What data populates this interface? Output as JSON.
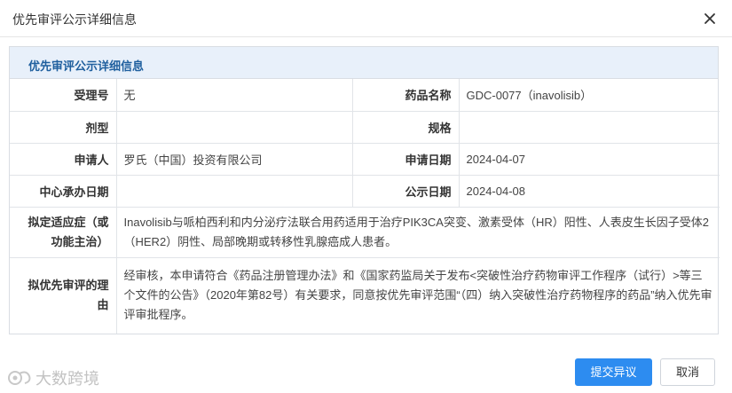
{
  "dialog": {
    "title": "优先审评公示详细信息",
    "close_icon": "close-icon"
  },
  "panel": {
    "heading": "优先审评公示详细信息"
  },
  "rows": [
    {
      "label1": "受理号",
      "value1": "无",
      "label2": "药品名称",
      "value2": "GDC-0077（inavolisib）"
    },
    {
      "label1": "剂型",
      "value1": "",
      "label2": "规格",
      "value2": ""
    },
    {
      "label1": "申请人",
      "value1": "罗氏（中国）投资有限公司",
      "label2": "申请日期",
      "value2": "2024-04-07"
    },
    {
      "label1": "中心承办日期",
      "value1": "",
      "label2": "公示日期",
      "value2": "2024-04-08"
    }
  ],
  "indication": {
    "label": "拟定适应症（或功能主治）",
    "value": "Inavolisib与哌柏西利和内分泌疗法联合用药适用于治疗PIK3CA突变、激素受体（HR）阳性、人表皮生长因子受体2（HER2）阴性、局部晚期或转移性乳腺癌成人患者。"
  },
  "reason": {
    "label": "拟优先审评的理由",
    "value": "经审核，本申请符合《药品注册管理办法》和《国家药监局关于发布<突破性治疗药物审评工作程序（试行）>等三个文件的公告》（2020年第82号）有关要求，同意按优先审评范围“（四）纳入突破性治疗药物程序的药品”纳入优先审评审批程序。"
  },
  "buttons": {
    "submit_objection": "提交异议",
    "cancel": "取消"
  },
  "watermark": {
    "text": "大数跨境",
    "icon": "brand-logo-icon"
  },
  "colors": {
    "primary": "#2d8cf0",
    "panel_head_bg": "#e8f0fa",
    "panel_head_text": "#1f5f9e"
  }
}
